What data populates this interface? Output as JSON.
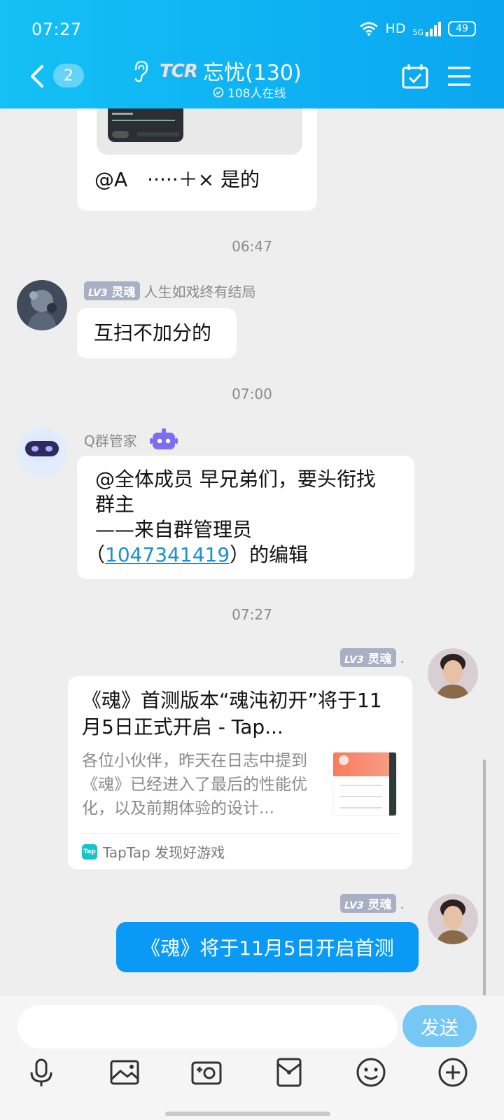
{
  "status_bar": {
    "time": "07:27",
    "network": "HD",
    "signal": "5G",
    "battery": "49"
  },
  "header": {
    "back_count": "2",
    "logo_text": "TCR",
    "title": "忘忧(130)",
    "online": "108人在线"
  },
  "messages": {
    "first_bubble_text": "@A　·····＋× 是的",
    "time1": "06:47",
    "sender1_level": "LV3",
    "sender1_title": "灵魂",
    "sender1_name": "人生如戏终有结局",
    "msg1": "互扫不加分的",
    "time2": "07:00",
    "sender2_name": "Q群管家",
    "msg2_line1": "@全体成员 早兄弟们，要头衔找",
    "msg2_line2": "群主",
    "msg2_line3": "——来自群管理员",
    "msg2_line4_open": "（",
    "msg2_link": "1047341419",
    "msg2_line4_close": "）的编辑",
    "time3": "07:27",
    "self_level": "LV3",
    "self_title": "灵魂",
    "self_dot": ".",
    "link_card": {
      "title": "《魂》首测版本“魂沌初开”将于11月5日正式开启 - Tap...",
      "desc": "各位小伙伴，昨天在日志中提到《魂》已经进入了最后的性能优化，以及前期体验的设计...",
      "source": "TapTap 发现好游戏",
      "source_icon": "Tap"
    },
    "self_msg": "《魂》将于11月5日开启首测"
  },
  "input": {
    "placeholder": "",
    "send_label": "发送"
  },
  "toolbar": [
    "voice-icon",
    "image-icon",
    "camera-icon",
    "red-packet-icon",
    "emoji-icon",
    "plus-icon"
  ],
  "colors": {
    "header": "#0aa6f0",
    "self_bubble": "#0a99f4",
    "send_button": "#77c7f5",
    "link": "#1a8fd1"
  }
}
